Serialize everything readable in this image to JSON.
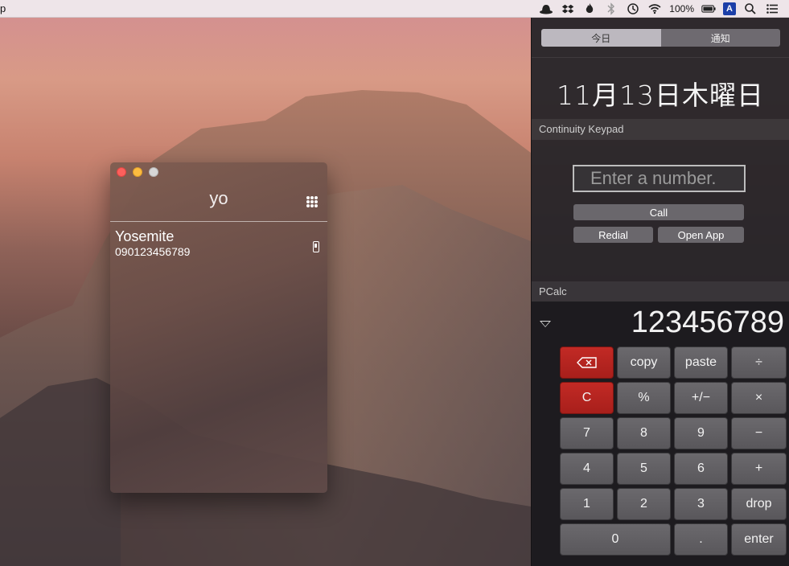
{
  "menubar": {
    "app_name": "p",
    "battery": "100%",
    "input_method": "A",
    "icons": [
      "hat-icon",
      "dropbox-icon",
      "flame-icon",
      "bluetooth-icon",
      "time-machine-icon",
      "wifi-icon",
      "battery-icon",
      "input-method-icon",
      "spotlight-icon",
      "notification-center-icon"
    ]
  },
  "yo_window": {
    "title": "yo",
    "contact": {
      "name": "Yosemite",
      "number": "090123456789"
    }
  },
  "notification_center": {
    "tabs": [
      {
        "label": "今日",
        "active": true
      },
      {
        "label": "通知",
        "active": false
      }
    ],
    "date": "11月13日木曜日",
    "continuity_keypad": {
      "title": "Continuity Keypad",
      "placeholder": "Enter a number.",
      "call_label": "Call",
      "redial_label": "Redial",
      "open_app_label": "Open App"
    },
    "pcalc": {
      "title": "PCalc",
      "display": "123456789",
      "keys": {
        "backspace": "⌫",
        "copy": "copy",
        "paste": "paste",
        "divide": "÷",
        "clear": "C",
        "percent": "%",
        "plusminus": "+/−",
        "multiply": "×",
        "seven": "7",
        "eight": "8",
        "nine": "9",
        "minus": "−",
        "four": "4",
        "five": "5",
        "six": "6",
        "plus": "+",
        "one": "1",
        "two": "2",
        "three": "3",
        "drop": "drop",
        "zero": "0",
        "point": ".",
        "enter": "enter"
      }
    }
  },
  "colors": {
    "close": "#fc605c",
    "minimize": "#fdbc40",
    "zoom": "#d7d7d7",
    "pcalc_red": "#b8241f"
  }
}
